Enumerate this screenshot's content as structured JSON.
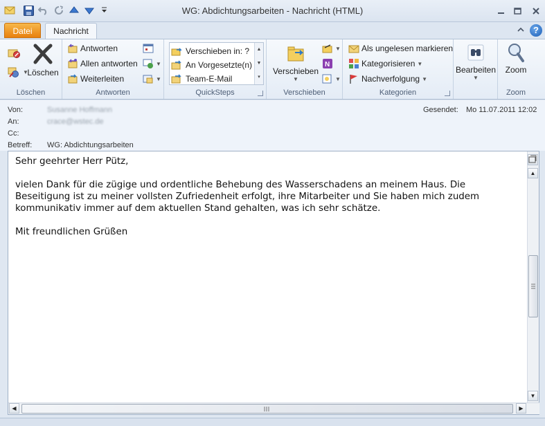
{
  "window": {
    "title": "WG: Abdichtungsarbeiten - Nachricht (HTML)"
  },
  "quick_access": [
    {
      "icon": "mail-icon"
    },
    {
      "icon": "save-icon"
    },
    {
      "icon": "undo-icon"
    },
    {
      "icon": "redo-icon"
    },
    {
      "icon": "arrow-up-icon"
    },
    {
      "icon": "arrow-down-icon"
    },
    {
      "icon": "customize-toolbar-icon"
    }
  ],
  "tabs": [
    {
      "label": "Datei",
      "active": false
    },
    {
      "label": "Nachricht",
      "active": true
    }
  ],
  "ribbon": {
    "groups": {
      "loeschen": {
        "label": "Löschen",
        "delete_label": "Löschen"
      },
      "antworten": {
        "label": "Antworten",
        "reply": "Antworten",
        "reply_all": "Allen antworten",
        "forward": "Weiterleiten"
      },
      "quicksteps": {
        "label": "QuickSteps",
        "items": [
          "Verschieben in: ?",
          "An Vorgesetzte(n)",
          "Team-E-Mail"
        ]
      },
      "verschieben": {
        "label": "Verschieben",
        "move_label": "Verschieben"
      },
      "kategorien": {
        "label": "Kategorien",
        "mark_unread": "Als ungelesen markieren",
        "categorize": "Kategorisieren",
        "followup": "Nachverfolgung"
      },
      "bearbeiten": {
        "label": "Bearbeiten"
      },
      "zoom": {
        "label": "Zoom",
        "button_label": "Zoom"
      }
    }
  },
  "header": {
    "from_label": "Von:",
    "from_value": "Susanne Hoffmann",
    "to_label": "An:",
    "to_value": "crace@wstec.de",
    "cc_label": "Cc:",
    "subject_label": "Betreff:",
    "subject_value": "WG: Abdichtungsarbeiten",
    "sent_label": "Gesendet:",
    "sent_value": "Mo 11.07.2011 12:02"
  },
  "body": {
    "greeting": "Sehr geehrter Herr Pütz,",
    "paragraph_lines": [
      "vielen Dank für die zügige und ordentliche Behebung des Wasserschadens an meinem Haus. Die",
      "Beseitigung ist zu meiner vollsten Zufriedenheit erfolgt, ihre Mitarbeiter und Sie haben mich zudem",
      "kommunikativ immer auf dem aktuellen Stand gehalten, was ich sehr schätze."
    ],
    "closing": "Mit freundlichen Grüßen"
  },
  "colors": {
    "datei_tab": "#e8800f",
    "ribbon_bg": "#eef3fa",
    "accent_blue": "#1d5fb7"
  }
}
